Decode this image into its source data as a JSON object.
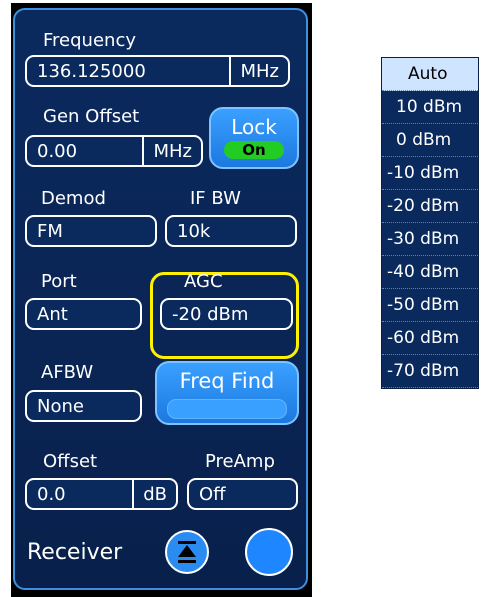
{
  "receiver": {
    "frequency": {
      "label": "Frequency",
      "value": "136.125000",
      "unit": "MHz"
    },
    "gen_offset": {
      "label": "Gen Offset",
      "value": "0.00",
      "unit": "MHz"
    },
    "lock": {
      "label": "Lock",
      "state": "On"
    },
    "demod": {
      "label": "Demod",
      "value": "FM"
    },
    "if_bw": {
      "label": "IF BW",
      "value": "10k"
    },
    "port": {
      "label": "Port",
      "value": "Ant"
    },
    "agc": {
      "label": "AGC",
      "value": "-20 dBm"
    },
    "afbw": {
      "label": "AFBW",
      "value": "None"
    },
    "freq_find": {
      "label": "Freq Find"
    },
    "offset": {
      "label": "Offset",
      "value": "0.0",
      "unit": "dB"
    },
    "preamp": {
      "label": "PreAmp",
      "value": "Off"
    },
    "footer": {
      "title": "Receiver",
      "collapse_icon": "collapse-up-icon",
      "action_icon": "circle-button-icon"
    }
  },
  "agc_dropdown": {
    "selected": "Auto",
    "items": [
      "Auto",
      "10 dBm",
      "0 dBm",
      "-10 dBm",
      "-20 dBm",
      "-30 dBm",
      "-40 dBm",
      "-50 dBm",
      "-60 dBm",
      "-70 dBm"
    ]
  },
  "colors": {
    "panel_background": "#0a2a5e",
    "panel_border": "#3f8fe0",
    "button_blue": "#1c78e0",
    "lock_on_green": "#22cc22",
    "highlight_yellow": "#ffef00",
    "dropdown_selected": "#cfe4ff"
  }
}
